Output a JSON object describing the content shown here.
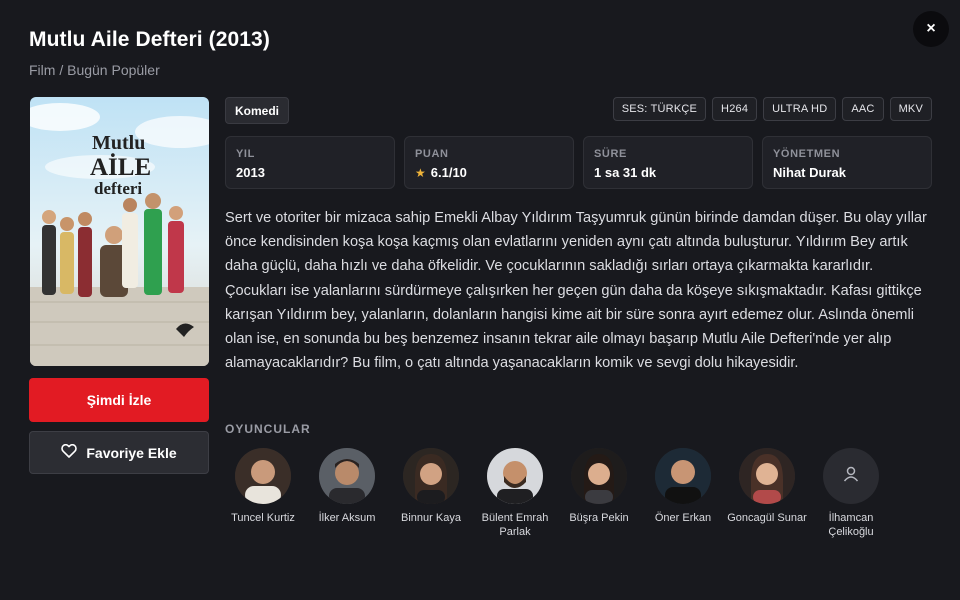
{
  "header": {
    "title": "Mutlu Aile Defteri (2013)",
    "breadcrumb": "Film / Bugün Popüler",
    "close_label": "×"
  },
  "poster": {
    "title_line1": "Mutlu",
    "title_line2": "AİLE",
    "title_line3": "defteri"
  },
  "actions": {
    "watch_label": "Şimdi İzle",
    "favorite_label": "Favoriye Ekle"
  },
  "genre": "Komedi",
  "tech_tags": [
    "SES: TÜRKÇE",
    "H264",
    "ULTRA HD",
    "AAC",
    "MKV"
  ],
  "info": {
    "year_label": "YIL",
    "year_value": "2013",
    "rating_label": "PUAN",
    "rating_value": "6.1/10",
    "duration_label": "SÜRE",
    "duration_value": "1 sa 31 dk",
    "director_label": "YÖNETMEN",
    "director_value": "Nihat Durak"
  },
  "description": "Sert ve otoriter bir mizaca sahip Emekli Albay Yıldırım Taşyumruk günün birinde damdan düşer. Bu olay yıllar önce kendisinden koşa koşa kaçmış olan evlatlarını yeniden aynı çatı altında buluşturur. Yıldırım Bey artık daha güçlü, daha hızlı ve daha öfkelidir. Ve çocuklarının sakladığı sırları ortaya çıkarmakta kararlıdır. Çocukları ise yalanlarını sürdürmeye çalışırken her geçen gün daha da köşeye sıkışmaktadır. Kafası gittikçe karışan Yıldırım bey, yalanların, dolanların hangisi kime ait bir süre sonra ayırt edemez olur.  Aslında önemli olan ise, en sonunda bu beş benzemez insanın tekrar aile olmayı başarıp Mutlu Aile Defteri'nde yer alıp alamayacaklarıdır?  Bu film, o çatı altında yaşanacakların komik ve sevgi dolu hikayesidir.",
  "cast": {
    "label": "OYUNCULAR",
    "members": [
      {
        "name": "Tuncel Kurtiz"
      },
      {
        "name": "İlker Aksum"
      },
      {
        "name": "Binnur Kaya"
      },
      {
        "name": "Bülent Emrah Parlak"
      },
      {
        "name": "Büşra Pekin"
      },
      {
        "name": "Öner Erkan"
      },
      {
        "name": "Goncagül Sunar"
      },
      {
        "name": "İlhamcan Çelikoğlu"
      }
    ]
  },
  "colors": {
    "background": "#18191e",
    "accent_red": "#e21b23",
    "star": "#f0b43a"
  }
}
